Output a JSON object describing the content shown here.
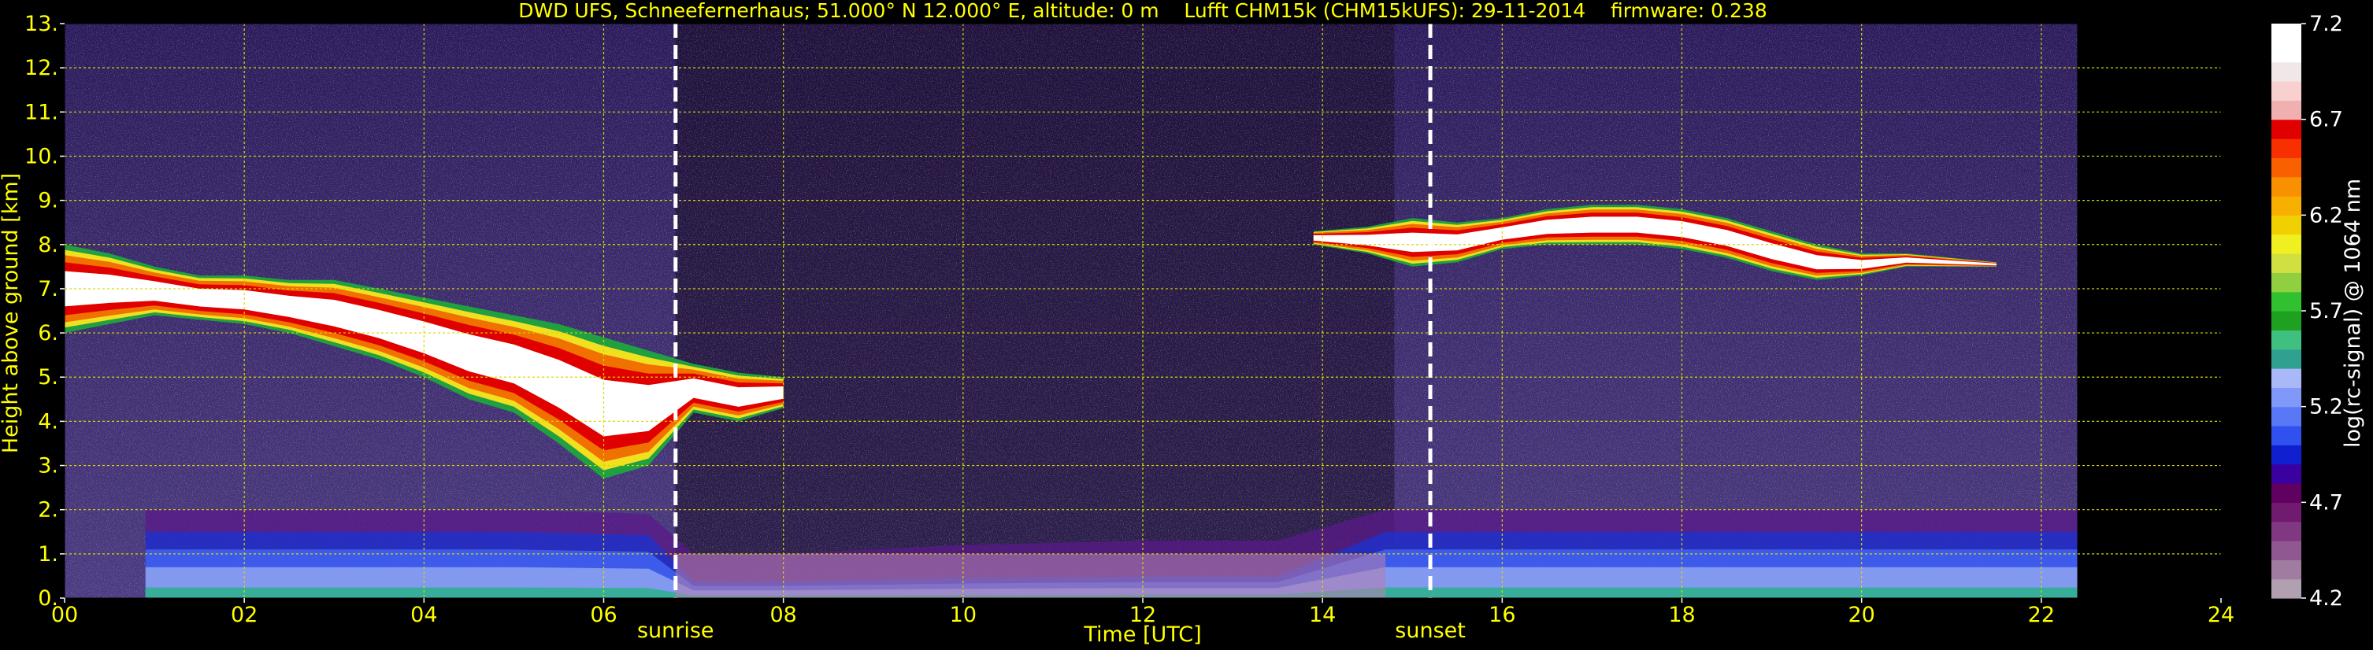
{
  "chart_data": {
    "type": "heatmap",
    "title": "DWD UFS, Schneefernerhaus; 51.000° N 12.000° E, altitude: 0 m    Lufft CHM15k (CHM15kUFS): 29-11-2014    firmware: 0.238",
    "xlabel": "Time [UTC]",
    "ylabel": "Height above ground [km]",
    "colorbar_label": "log(rc-signal) @ 1064 nm",
    "xlim": [
      0,
      24
    ],
    "ylim": [
      0,
      13
    ],
    "data_end_hour": 22.4,
    "x_ticks": [
      0,
      2,
      4,
      6,
      8,
      10,
      12,
      14,
      16,
      18,
      20,
      22,
      24
    ],
    "x_tick_labels": [
      "00",
      "02",
      "04",
      "06",
      "08",
      "10",
      "12",
      "14",
      "16",
      "18",
      "20",
      "22",
      "24"
    ],
    "y_ticks": [
      0,
      1,
      2,
      3,
      4,
      5,
      6,
      7,
      8,
      9,
      10,
      11,
      12,
      13
    ],
    "y_tick_labels": [
      "0.",
      "1.",
      "2.",
      "3.",
      "4.",
      "5.",
      "6.",
      "7.",
      "8.",
      "9.",
      "10.",
      "11.",
      "12.",
      "13."
    ],
    "grid": true,
    "annotations": [
      {
        "label": "sunrise",
        "x": 6.8
      },
      {
        "label": "sunset",
        "x": 15.2
      }
    ],
    "colorbar": {
      "range": [
        4.2,
        7.2
      ],
      "ticks": [
        4.2,
        4.7,
        5.2,
        5.7,
        6.2,
        6.7,
        7.2
      ],
      "tick_labels": [
        "4.2",
        "4.7",
        "5.2",
        "5.7",
        "6.2",
        "6.7",
        "7.2"
      ],
      "colors": [
        "#b0a0b0",
        "#a07ca0",
        "#905890",
        "#803880",
        "#701a70",
        "#600060",
        "#3a00a0",
        "#1020d0",
        "#3050f0",
        "#5878f8",
        "#8098f8",
        "#a8b8f8",
        "#30a090",
        "#40c080",
        "#20a020",
        "#30c030",
        "#90d040",
        "#d0e040",
        "#f0f020",
        "#f0d000",
        "#f8b000",
        "#f89000",
        "#f86000",
        "#f83000",
        "#e00000",
        "#f0b0b0",
        "#f8d0d0",
        "#f0e8e8",
        "#ffffff",
        "#ffffff"
      ]
    },
    "series": [
      {
        "name": "cloud layer morning",
        "kind": "cloud",
        "x": [
          0.0,
          0.5,
          1.0,
          1.5,
          2.0,
          2.5,
          3.0,
          3.5,
          4.0,
          4.5,
          5.0,
          5.5,
          6.0,
          6.5,
          7.0,
          7.5,
          8.0
        ],
        "top_km": [
          8.0,
          7.8,
          7.5,
          7.3,
          7.3,
          7.2,
          7.2,
          7.0,
          6.8,
          6.6,
          6.4,
          6.2,
          5.9,
          5.6,
          5.3,
          5.1,
          5.0
        ],
        "base_km": [
          6.0,
          6.2,
          6.4,
          6.3,
          6.2,
          6.0,
          5.7,
          5.4,
          5.0,
          4.5,
          4.2,
          3.5,
          2.7,
          3.0,
          4.2,
          4.0,
          4.3
        ]
      },
      {
        "name": "cloud layer evening",
        "kind": "cloud",
        "x": [
          13.9,
          14.5,
          15.0,
          15.5,
          16.0,
          16.5,
          17.0,
          17.5,
          18.0,
          18.5,
          19.0,
          19.5,
          20.0,
          20.5,
          21.0,
          21.5
        ],
        "top_km": [
          8.3,
          8.4,
          8.6,
          8.5,
          8.6,
          8.8,
          8.9,
          8.9,
          8.8,
          8.6,
          8.3,
          8.0,
          7.8,
          7.8,
          7.7,
          7.6
        ],
        "base_km": [
          8.0,
          7.8,
          7.5,
          7.6,
          7.9,
          8.0,
          8.0,
          8.0,
          7.9,
          7.7,
          7.4,
          7.2,
          7.3,
          7.5,
          7.5,
          7.5
        ]
      },
      {
        "name": "boundary layer",
        "kind": "aerosol",
        "x": [
          0.9,
          3.0,
          5.0,
          6.5,
          7.0,
          8.0,
          10.0,
          12.0,
          13.5,
          14.7,
          15.2,
          18.0,
          20.0,
          22.4
        ],
        "top_km": [
          2.0,
          2.0,
          2.0,
          1.9,
          1.0,
          1.0,
          1.2,
          1.3,
          1.3,
          2.0,
          2.0,
          2.0,
          2.0,
          2.0
        ]
      }
    ]
  }
}
